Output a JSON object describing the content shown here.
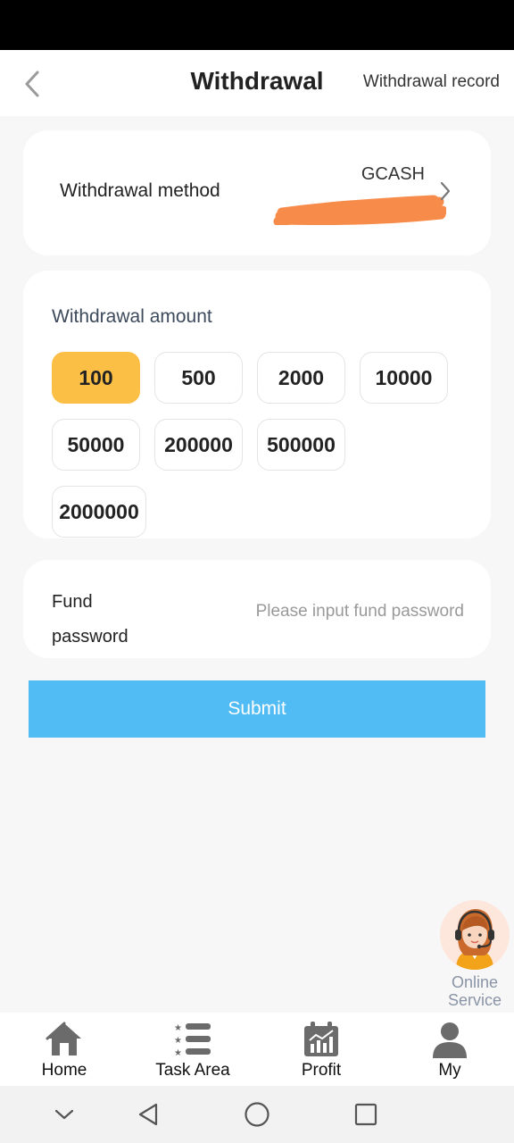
{
  "header": {
    "title": "Withdrawal",
    "record_link": "Withdrawal record"
  },
  "method": {
    "label": "Withdrawal method",
    "value": "GCASH",
    "account_redacted": true
  },
  "amount": {
    "label": "Withdrawal amount",
    "options": [
      "100",
      "500",
      "2000",
      "10000",
      "50000",
      "200000",
      "500000",
      "2000000"
    ],
    "selected": "100",
    "selected_color": "#fbbf46"
  },
  "password": {
    "label": "Fund password",
    "placeholder": "Please input fund password",
    "value": ""
  },
  "submit": {
    "label": "Submit",
    "color": "#51bbf3"
  },
  "online_service": {
    "label": "Online Service",
    "icon": "customer-service-agent-icon"
  },
  "tabs": [
    {
      "label": "Home",
      "icon": "home-icon"
    },
    {
      "label": "Task Area",
      "icon": "task-list-icon"
    },
    {
      "label": "Profit",
      "icon": "chart-calendar-icon"
    },
    {
      "label": "My",
      "icon": "user-icon"
    }
  ],
  "system_nav": [
    "chevron-down-icon",
    "back-triangle-icon",
    "home-circle-icon",
    "recents-square-icon"
  ]
}
